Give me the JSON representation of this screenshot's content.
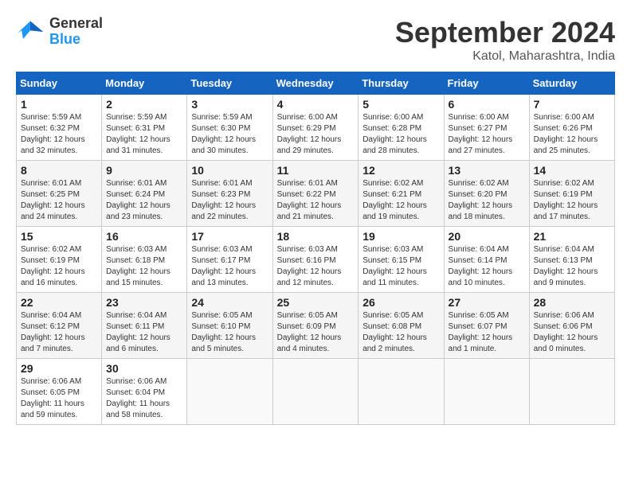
{
  "header": {
    "logo_line1": "General",
    "logo_line2": "Blue",
    "title": "September 2024",
    "subtitle": "Katol, Maharashtra, India"
  },
  "weekdays": [
    "Sunday",
    "Monday",
    "Tuesday",
    "Wednesday",
    "Thursday",
    "Friday",
    "Saturday"
  ],
  "weeks": [
    [
      {
        "day": "1",
        "info": "Sunrise: 5:59 AM\nSunset: 6:32 PM\nDaylight: 12 hours\nand 32 minutes."
      },
      {
        "day": "2",
        "info": "Sunrise: 5:59 AM\nSunset: 6:31 PM\nDaylight: 12 hours\nand 31 minutes."
      },
      {
        "day": "3",
        "info": "Sunrise: 5:59 AM\nSunset: 6:30 PM\nDaylight: 12 hours\nand 30 minutes."
      },
      {
        "day": "4",
        "info": "Sunrise: 6:00 AM\nSunset: 6:29 PM\nDaylight: 12 hours\nand 29 minutes."
      },
      {
        "day": "5",
        "info": "Sunrise: 6:00 AM\nSunset: 6:28 PM\nDaylight: 12 hours\nand 28 minutes."
      },
      {
        "day": "6",
        "info": "Sunrise: 6:00 AM\nSunset: 6:27 PM\nDaylight: 12 hours\nand 27 minutes."
      },
      {
        "day": "7",
        "info": "Sunrise: 6:00 AM\nSunset: 6:26 PM\nDaylight: 12 hours\nand 25 minutes."
      }
    ],
    [
      {
        "day": "8",
        "info": "Sunrise: 6:01 AM\nSunset: 6:25 PM\nDaylight: 12 hours\nand 24 minutes."
      },
      {
        "day": "9",
        "info": "Sunrise: 6:01 AM\nSunset: 6:24 PM\nDaylight: 12 hours\nand 23 minutes."
      },
      {
        "day": "10",
        "info": "Sunrise: 6:01 AM\nSunset: 6:23 PM\nDaylight: 12 hours\nand 22 minutes."
      },
      {
        "day": "11",
        "info": "Sunrise: 6:01 AM\nSunset: 6:22 PM\nDaylight: 12 hours\nand 21 minutes."
      },
      {
        "day": "12",
        "info": "Sunrise: 6:02 AM\nSunset: 6:21 PM\nDaylight: 12 hours\nand 19 minutes."
      },
      {
        "day": "13",
        "info": "Sunrise: 6:02 AM\nSunset: 6:20 PM\nDaylight: 12 hours\nand 18 minutes."
      },
      {
        "day": "14",
        "info": "Sunrise: 6:02 AM\nSunset: 6:19 PM\nDaylight: 12 hours\nand 17 minutes."
      }
    ],
    [
      {
        "day": "15",
        "info": "Sunrise: 6:02 AM\nSunset: 6:19 PM\nDaylight: 12 hours\nand 16 minutes."
      },
      {
        "day": "16",
        "info": "Sunrise: 6:03 AM\nSunset: 6:18 PM\nDaylight: 12 hours\nand 15 minutes."
      },
      {
        "day": "17",
        "info": "Sunrise: 6:03 AM\nSunset: 6:17 PM\nDaylight: 12 hours\nand 13 minutes."
      },
      {
        "day": "18",
        "info": "Sunrise: 6:03 AM\nSunset: 6:16 PM\nDaylight: 12 hours\nand 12 minutes."
      },
      {
        "day": "19",
        "info": "Sunrise: 6:03 AM\nSunset: 6:15 PM\nDaylight: 12 hours\nand 11 minutes."
      },
      {
        "day": "20",
        "info": "Sunrise: 6:04 AM\nSunset: 6:14 PM\nDaylight: 12 hours\nand 10 minutes."
      },
      {
        "day": "21",
        "info": "Sunrise: 6:04 AM\nSunset: 6:13 PM\nDaylight: 12 hours\nand 9 minutes."
      }
    ],
    [
      {
        "day": "22",
        "info": "Sunrise: 6:04 AM\nSunset: 6:12 PM\nDaylight: 12 hours\nand 7 minutes."
      },
      {
        "day": "23",
        "info": "Sunrise: 6:04 AM\nSunset: 6:11 PM\nDaylight: 12 hours\nand 6 minutes."
      },
      {
        "day": "24",
        "info": "Sunrise: 6:05 AM\nSunset: 6:10 PM\nDaylight: 12 hours\nand 5 minutes."
      },
      {
        "day": "25",
        "info": "Sunrise: 6:05 AM\nSunset: 6:09 PM\nDaylight: 12 hours\nand 4 minutes."
      },
      {
        "day": "26",
        "info": "Sunrise: 6:05 AM\nSunset: 6:08 PM\nDaylight: 12 hours\nand 2 minutes."
      },
      {
        "day": "27",
        "info": "Sunrise: 6:05 AM\nSunset: 6:07 PM\nDaylight: 12 hours\nand 1 minute."
      },
      {
        "day": "28",
        "info": "Sunrise: 6:06 AM\nSunset: 6:06 PM\nDaylight: 12 hours\nand 0 minutes."
      }
    ],
    [
      {
        "day": "29",
        "info": "Sunrise: 6:06 AM\nSunset: 6:05 PM\nDaylight: 11 hours\nand 59 minutes."
      },
      {
        "day": "30",
        "info": "Sunrise: 6:06 AM\nSunset: 6:04 PM\nDaylight: 11 hours\nand 58 minutes."
      },
      {
        "day": "",
        "info": ""
      },
      {
        "day": "",
        "info": ""
      },
      {
        "day": "",
        "info": ""
      },
      {
        "day": "",
        "info": ""
      },
      {
        "day": "",
        "info": ""
      }
    ]
  ]
}
